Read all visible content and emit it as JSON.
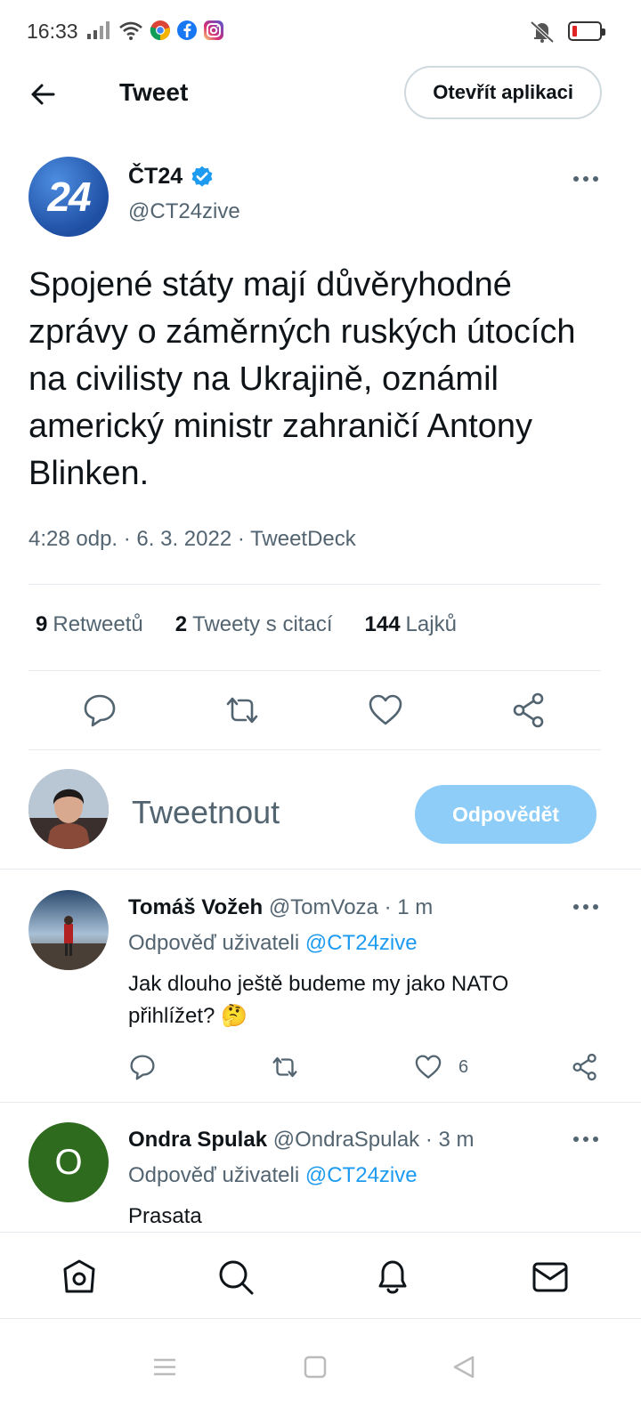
{
  "status_bar": {
    "time": "16:33",
    "accent_colors": {
      "battery_low": "#e02424"
    }
  },
  "header": {
    "title": "Tweet",
    "open_app_label": "Otevřít aplikaci"
  },
  "tweet": {
    "author_name": "ČT24",
    "author_handle": "@CT24zive",
    "avatar_text": "24",
    "text": "Spojené státy mají důvěryhodné zprávy o záměrných ruských útocích na civilisty na Ukrajině, oznámil americký ministr zahraničí Antony Blinken.",
    "meta": "4:28 odp. · 6. 3. 2022 · TweetDeck",
    "stats": [
      {
        "count": "9",
        "label": "Retweetů"
      },
      {
        "count": "2",
        "label": "Tweety s citací"
      },
      {
        "count": "144",
        "label": "Lajků"
      }
    ]
  },
  "compose": {
    "placeholder": "Tweetnout",
    "reply_button": "Odpovědět",
    "reply_button_color": "#8ecdf8"
  },
  "replies": [
    {
      "name": "Tomáš Vožeh",
      "handle": "@TomVoza",
      "time": "· 1 m",
      "reply_to_prefix": "Odpověď uživateli",
      "reply_to_handle": "@CT24zive",
      "text": "Jak dlouho ještě budeme my jako NATO přihlížet? 🤔",
      "like_count": "6"
    },
    {
      "name": "Ondra Spulak",
      "handle": "@OndraSpulak",
      "time": "· 3 m",
      "reply_to_prefix": "Odpověď uživateli",
      "reply_to_handle": "@CT24zive",
      "text": "Prasata",
      "avatar_letter": "O",
      "avatar_color": "#2e6b1f"
    }
  ],
  "icons": {
    "back": "arrow-left-icon",
    "verified": "verified-badge-icon",
    "reply": "comment-icon",
    "retweet": "retweet-icon",
    "like": "heart-icon",
    "share": "share-icon",
    "home": "home-icon",
    "search": "search-icon",
    "notifications": "bell-icon",
    "messages": "mail-icon"
  },
  "link_color": "#1d9bf0"
}
